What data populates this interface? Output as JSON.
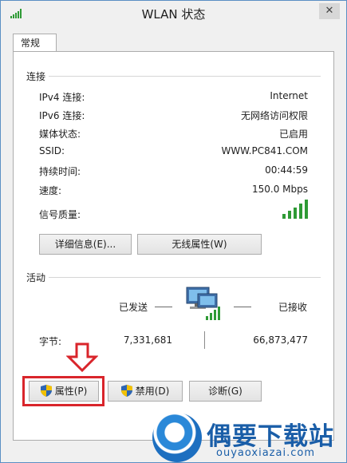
{
  "window": {
    "title": "WLAN 状态",
    "close_label": "✕",
    "tab_label": "常规"
  },
  "connection": {
    "section_title": "连接",
    "rows": [
      {
        "label": "IPv4 连接:",
        "value": "Internet"
      },
      {
        "label": "IPv6 连接:",
        "value": "无网络访问权限"
      },
      {
        "label": "媒体状态:",
        "value": "已启用"
      },
      {
        "label": "SSID:",
        "value": "WWW.PC841.COM"
      },
      {
        "label": "持续时间:",
        "value": "00:44:59"
      },
      {
        "label": "速度:",
        "value": "150.0 Mbps"
      }
    ],
    "signal_label": "信号质量:",
    "signal_bars": 5,
    "signal_max": 5,
    "details_button": "详细信息(E)...",
    "wireless_props_button": "无线属性(W)"
  },
  "activity": {
    "section_title": "活动",
    "sent_label": "已发送",
    "received_label": "已接收",
    "bytes_label": "字节:",
    "bytes_sent": "7,331,681",
    "bytes_received": "66,873,477"
  },
  "bottom_buttons": {
    "properties": "属性(P)",
    "disable": "禁用(D)",
    "diagnose": "诊断(G)"
  },
  "watermark": {
    "title": "偶要下载站",
    "url": "ouyaoxiazai.com"
  },
  "colors": {
    "signal_green": "#2e9a35",
    "highlight_red": "#d9252b",
    "watermark_blue": "#1a5ea8"
  }
}
